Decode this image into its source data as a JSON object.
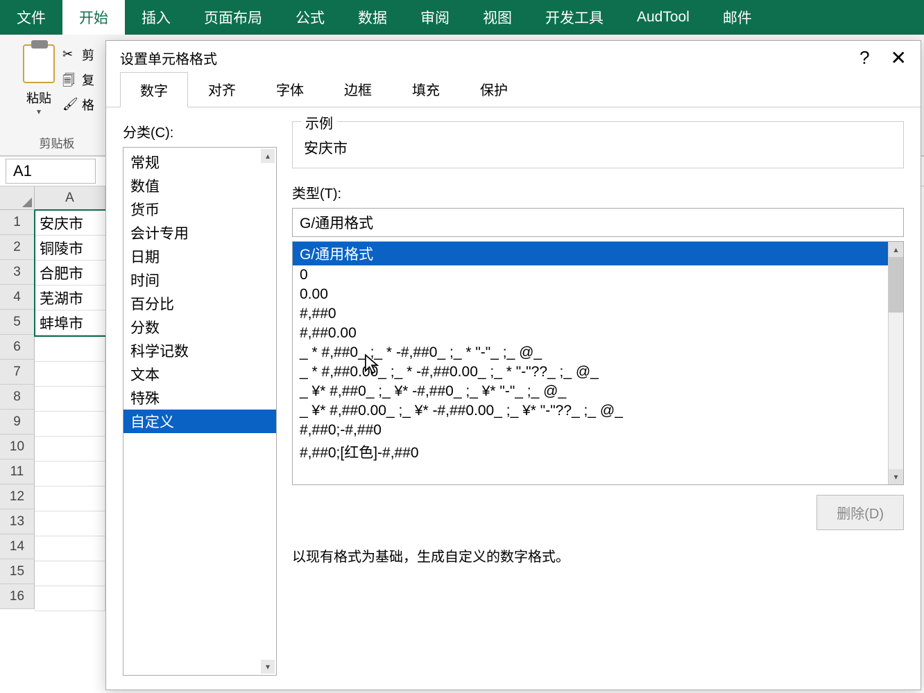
{
  "ribbon": {
    "tabs": [
      "文件",
      "开始",
      "插入",
      "页面布局",
      "公式",
      "数据",
      "审阅",
      "视图",
      "开发工具",
      "AudTool",
      "邮件"
    ],
    "active_index": 1
  },
  "clipboard": {
    "paste": "粘贴",
    "cut": "剪",
    "copy": "复",
    "format": "格",
    "group_label": "剪贴板"
  },
  "namebox": "A1",
  "sheet": {
    "col_header": "A",
    "rows": [
      "1",
      "2",
      "3",
      "4",
      "5",
      "6",
      "7",
      "8",
      "9",
      "10",
      "11",
      "12",
      "13",
      "14",
      "15",
      "16"
    ],
    "cells": [
      "安庆市",
      "铜陵市",
      "合肥市",
      "芜湖市",
      "蚌埠市"
    ]
  },
  "dialog": {
    "title": "设置单元格格式",
    "tabs": [
      "数字",
      "对齐",
      "字体",
      "边框",
      "填充",
      "保护"
    ],
    "active_tab": 0,
    "category_label": "分类(C):",
    "categories": [
      "常规",
      "数值",
      "货币",
      "会计专用",
      "日期",
      "时间",
      "百分比",
      "分数",
      "科学记数",
      "文本",
      "特殊",
      "自定义"
    ],
    "selected_category": 11,
    "example_label": "示例",
    "example_value": "安庆市",
    "type_label": "类型(T):",
    "type_input": "G/通用格式",
    "type_list": [
      "G/通用格式",
      "0",
      "0.00",
      "#,##0",
      "#,##0.00",
      "_ * #,##0_ ;_ * -#,##0_ ;_ * \"-\"_ ;_ @_",
      "_ * #,##0.00_ ;_ * -#,##0.00_ ;_ * \"-\"??_ ;_ @_",
      "_ ¥* #,##0_ ;_ ¥* -#,##0_ ;_ ¥* \"-\"_ ;_ @_",
      "_ ¥* #,##0.00_ ;_ ¥* -#,##0.00_ ;_ ¥* \"-\"??_ ;_ @_",
      "#,##0;-#,##0",
      "#,##0;[红色]-#,##0"
    ],
    "selected_type": 0,
    "delete_btn": "删除(D)",
    "hint": "以现有格式为基础，生成自定义的数字格式。"
  }
}
